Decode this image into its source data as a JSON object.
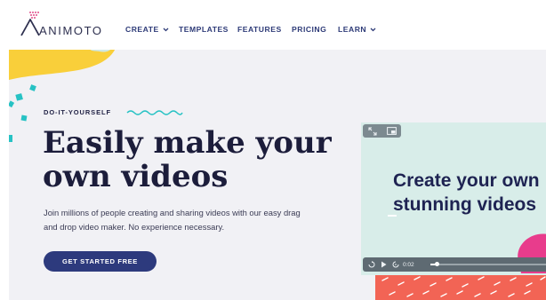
{
  "brand": {
    "name": "ANIMOTO"
  },
  "nav": {
    "items": [
      {
        "label": "CREATE",
        "dropdown": true
      },
      {
        "label": "TEMPLATES",
        "dropdown": false
      },
      {
        "label": "FEATURES",
        "dropdown": false
      },
      {
        "label": "PRICING",
        "dropdown": false
      },
      {
        "label": "LEARN",
        "dropdown": true
      }
    ]
  },
  "hero": {
    "eyebrow": "DO-IT-YOURSELF",
    "headline_line1": "Easily make your",
    "headline_line2": "own videos",
    "description_line1": "Join millions of people creating and sharing videos with our easy drag",
    "description_line2": "and drop video maker. No experience necessary.",
    "cta_label": "GET STARTED FREE"
  },
  "video": {
    "title_line1": "Create your own",
    "title_line2": "stunning videos",
    "time": "0:02",
    "progress": 0.05
  },
  "colors": {
    "accent_navy": "#2d3a7d",
    "headline": "#1c1d3b",
    "yellow_blob": "#f9cf3a",
    "teal_confetti": "#27c2c4",
    "pink": "#e83c8c",
    "coral": "#f26455"
  }
}
